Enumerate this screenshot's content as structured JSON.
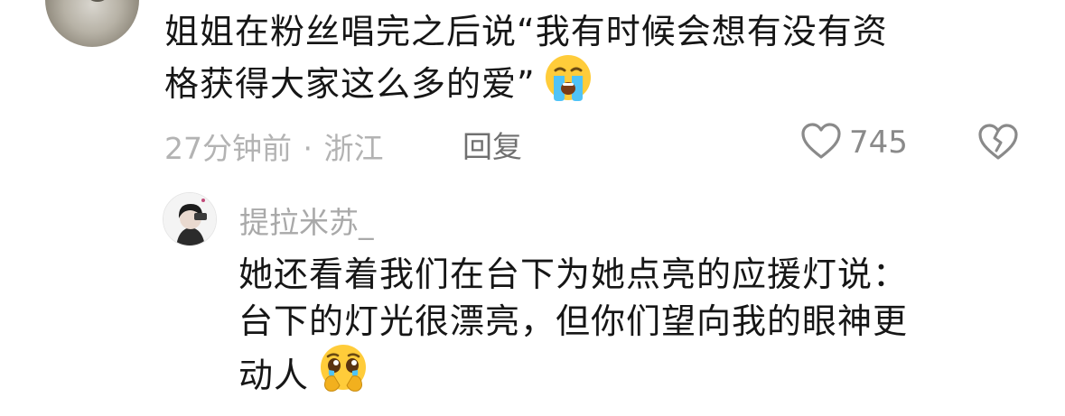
{
  "comment": {
    "text_line1": "姐姐在粉丝唱完之后说“我有时候会想有没有资",
    "text_line2": "格获得大家这么多的爱”",
    "emoji": "crying-face-emoji",
    "time": "27分钟前",
    "separator": "·",
    "location": "浙江",
    "reply_label": "回复",
    "like_count": "745"
  },
  "reply": {
    "username": "提拉米苏_",
    "text_line1": "她还看着我们在台下为她点亮的应援灯说：",
    "text_line2": "台下的灯光很漂亮，但你们望向我的眼神更",
    "text_line3": "动人",
    "emoji": "pleading-face-holding-back-tears-emoji"
  },
  "colors": {
    "text": "#161616",
    "meta": "#b3b3b3",
    "reply_label": "#707070",
    "icon": "#8a8a8a",
    "emoji_yellow": "#FFCC3A",
    "emoji_tear": "#4FC3F7"
  }
}
